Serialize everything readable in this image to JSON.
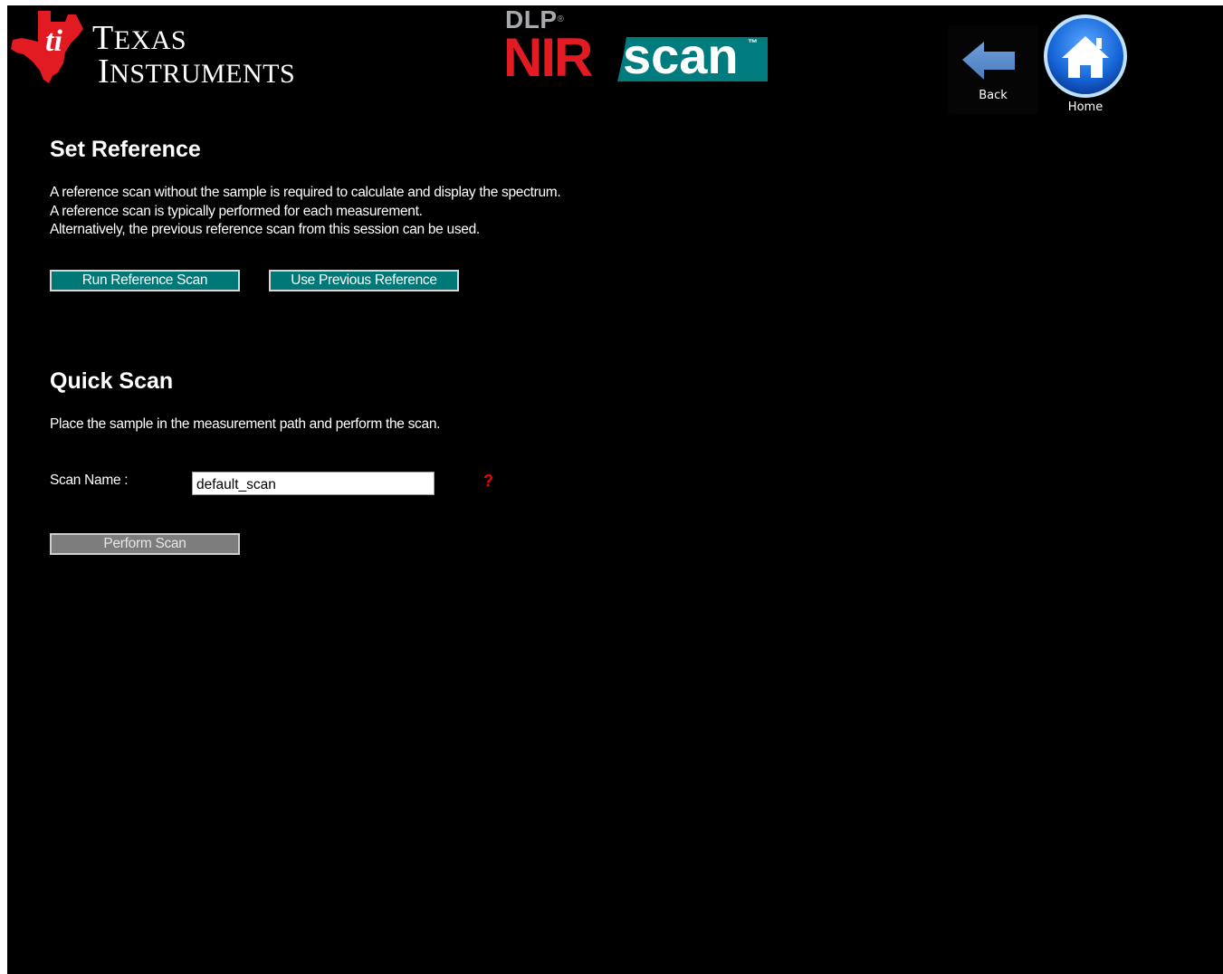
{
  "header": {
    "ti_logo": {
      "icon": "ti-state-logo-icon",
      "word1_initial": "T",
      "word1_rest": "EXAS",
      "word2_initial": "I",
      "word2_rest": "NSTRUMENTS",
      "color": "#e21b22"
    },
    "product_logo": {
      "dlp": "DLP",
      "dlp_mark": "®",
      "nir": "NIR",
      "scan": "scan",
      "tm": "™",
      "colors": {
        "dlp": "#a7a9ac",
        "nir": "#e21b22",
        "scan_bg": "#007c7f"
      }
    },
    "nav": {
      "back": {
        "label": "Back",
        "icon": "left-arrow-icon"
      },
      "home": {
        "label": "Home",
        "icon": "house-icon"
      }
    }
  },
  "set_reference": {
    "title": "Set Reference",
    "lines": [
      "A reference scan without the sample is required to calculate and display the spectrum.",
      "A reference scan is typically performed for each measurement.",
      "Alternatively, the previous reference scan from this session can be used."
    ],
    "run_reference_button": "Run Reference Scan",
    "use_previous_button": "Use Previous Reference"
  },
  "quick_scan": {
    "title": "Quick Scan",
    "description": "Place the sample in the measurement path and perform the scan.",
    "scan_name_label": "Scan Name :",
    "scan_name_value": "default_scan",
    "help_symbol": "?",
    "perform_scan_button": "Perform Scan"
  },
  "colors": {
    "background": "#000000",
    "button_teal": "#007878",
    "button_disabled": "#7d7d7d",
    "help_red": "#ff0000"
  }
}
